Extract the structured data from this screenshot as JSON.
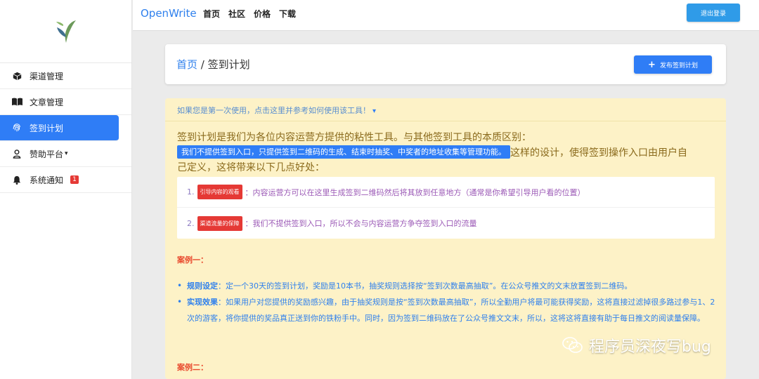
{
  "sidebar": {
    "items": [
      {
        "label": "渠道管理",
        "icon": "cube-icon"
      },
      {
        "label": "文章管理",
        "icon": "book-icon"
      },
      {
        "label": "签到计划",
        "icon": "fingerprint-icon"
      },
      {
        "label": "赞助平台",
        "icon": "user-icon"
      },
      {
        "label": "系统通知",
        "icon": "bell-icon",
        "badge": "1"
      }
    ]
  },
  "topbar": {
    "brand": "OpenWrite",
    "nav": [
      "首页",
      "社区",
      "价格",
      "下载"
    ],
    "logout": "退出登录"
  },
  "header": {
    "home": "首页",
    "separator": " / ",
    "current": "签到计划",
    "publish": "发布签到计划"
  },
  "main": {
    "hint": "如果您是第一次使用，点击这里并参考如何使用该工具！",
    "intro_line1": "签到计划是我们为各位内容运营方提供的粘性工具。与其他签到工具的本质区别：",
    "intro_highlight": "我们不提供签到入口，只提供签到二维码的生成、结束时抽奖、中奖者的地址收集等管理功能。",
    "intro_line2_rest": "这样的设计，使得签到操作入口由用户自",
    "intro_line3": "己定义，这将带来以下几点好处：",
    "points": [
      {
        "num": "1.",
        "tag": "引导内容的观看",
        "text": "：内容运营方可以在这里生成签到二维码然后将其放到任意地方（通常是你希望引导用户看的位置）"
      },
      {
        "num": "2.",
        "tag": "渠道流量的保障",
        "text": "：我们不提供签到入口，所以不会与内容运营方争夺签到入口的流量"
      }
    ],
    "case1_title": "案例一：",
    "case1_bullets": [
      {
        "label": "规则设定",
        "text": "：定一个30天的签到计划，奖励是10本书，抽奖规则选择按“签到次数最高抽取”。在公众号推文的文末放置签到二维码。"
      },
      {
        "label": "实现效果",
        "text": "：如果用户对您提供的奖励感兴趣，由于抽奖规则是按“签到次数最高抽取”，所以全勤用户将最可能获得奖励，这将直接过滤掉很多路过参与1、2次的游客，将你提供的奖品真正送到你的铁粉手中。同时，因为签到二维码放在了公众号推文文末，所以，这将这将直接有助于每日推文的阅读量保障。"
      }
    ],
    "case2_title": "案例二："
  },
  "watermark": "程序员深夜写bug"
}
